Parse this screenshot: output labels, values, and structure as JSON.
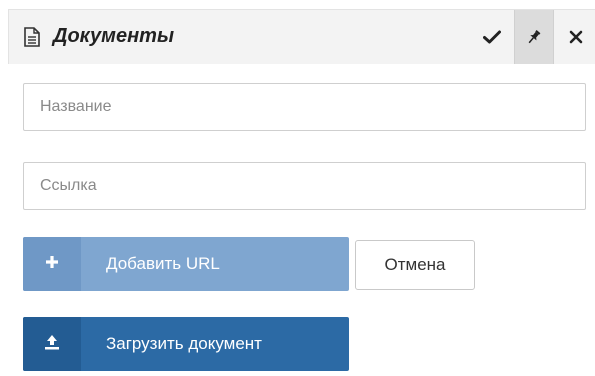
{
  "header": {
    "title": "Документы",
    "icon": "document-icon",
    "actions": {
      "confirm_icon": "check-icon",
      "pin_icon": "pin-icon",
      "close_icon": "close-icon"
    }
  },
  "form": {
    "name_field": {
      "placeholder": "Название",
      "value": ""
    },
    "link_field": {
      "placeholder": "Ссылка",
      "value": ""
    }
  },
  "buttons": {
    "add_url": {
      "label": "Добавить URL",
      "icon": "plus-icon",
      "color": "#7fa6d0"
    },
    "cancel": {
      "label": "Отмена"
    },
    "upload": {
      "label": "Загрузить документ",
      "icon": "upload-icon",
      "color": "#2c6aa5"
    }
  }
}
